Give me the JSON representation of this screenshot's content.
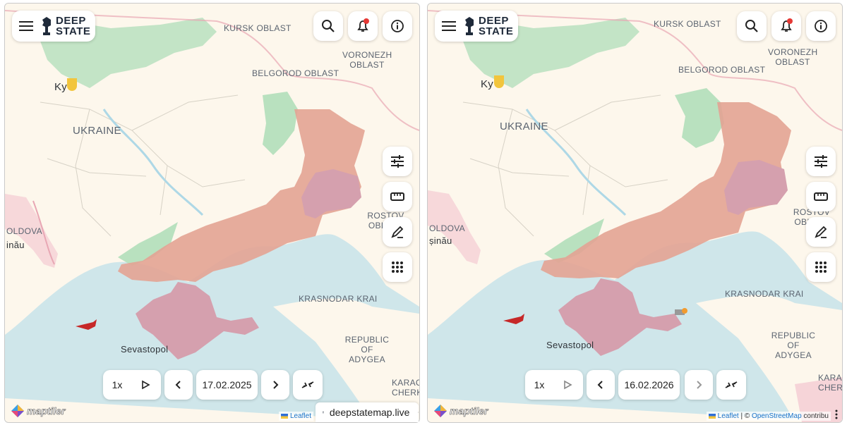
{
  "colors": {
    "land": "#fdf7ec",
    "sea": "#cfe6ea",
    "occupied": "#e3a393",
    "crimea": "#d5a0ae",
    "liberated": "#b9e1bf",
    "border": "#e8a7b4",
    "accent_red": "#e53935"
  },
  "app": {
    "logo_line1": "DEEP",
    "logo_line2": "STATE"
  },
  "left": {
    "labels": {
      "kursk": "KURSK OBLAST",
      "voronezh": "VORONEZH OBLAST",
      "belgorod": "BELGOROD OBLAST",
      "ukraine": "UKRAINE",
      "rostov": "ROSTOV OBLAST",
      "krasnodar": "KRASNODAR KRAI",
      "adygea": "REPUBLIC OF ADYGEA",
      "karach": "KARACI CHERK",
      "moldova": "OLDOVA",
      "chisinau": "inău",
      "kyiv": "Ky",
      "sevastopol": "Sevastopol"
    },
    "controls": {
      "speed": "1x",
      "date": "17.02.2025"
    },
    "attribution": {
      "leaflet": "Leaflet",
      "maptiler": "maptiler"
    },
    "site_tag": "deepstatemap.live"
  },
  "right": {
    "labels": {
      "kursk": "KURSK OBLAST",
      "voronezh": "VORONEZH OBLAST",
      "belgorod": "BELGOROD OBLAST",
      "ukraine": "UKRAINE",
      "rostov": "ROSTOV OBLAST",
      "krasnodar": "KRASNODAR KRAI",
      "adygea": "REPUBLIC OF ADYGEA",
      "karach": "KARAC CHER",
      "moldova": "OLDOVA",
      "chisinau": "șinău",
      "kyiv": "Ky",
      "sevastopol": "Sevastopol"
    },
    "controls": {
      "speed": "1x",
      "date": "16.02.2026"
    },
    "attribution": {
      "leaflet": "Leaflet",
      "separator": "|",
      "copyright": "©",
      "osm": "OpenStreetMap",
      "contrib": "contribu",
      "maptiler": "maptiler"
    }
  },
  "icons": {
    "menu": "menu-icon",
    "search": "search-icon",
    "bell": "bell-icon",
    "info": "info-icon",
    "filters": "sliders-icon",
    "ruler": "ruler-icon",
    "draw": "pen-icon",
    "grid": "grid-icon",
    "play": "play-icon",
    "prev": "chevron-left-icon",
    "next": "chevron-right-icon",
    "collapse": "collapse-icon",
    "more": "more-vertical-icon"
  }
}
